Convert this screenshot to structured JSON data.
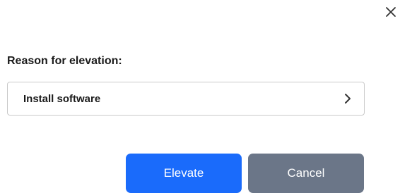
{
  "dialog": {
    "reason_label": "Reason for elevation:",
    "reason_select": {
      "value": "Install software",
      "chevron_icon": "chevron-right-icon"
    },
    "close_icon": "close-icon",
    "buttons": {
      "elevate_label": "Elevate",
      "cancel_label": "Cancel"
    }
  },
  "colors": {
    "elevate": "#1a6bfb",
    "cancel": "#6b7688",
    "text": "#1a1a1a"
  }
}
